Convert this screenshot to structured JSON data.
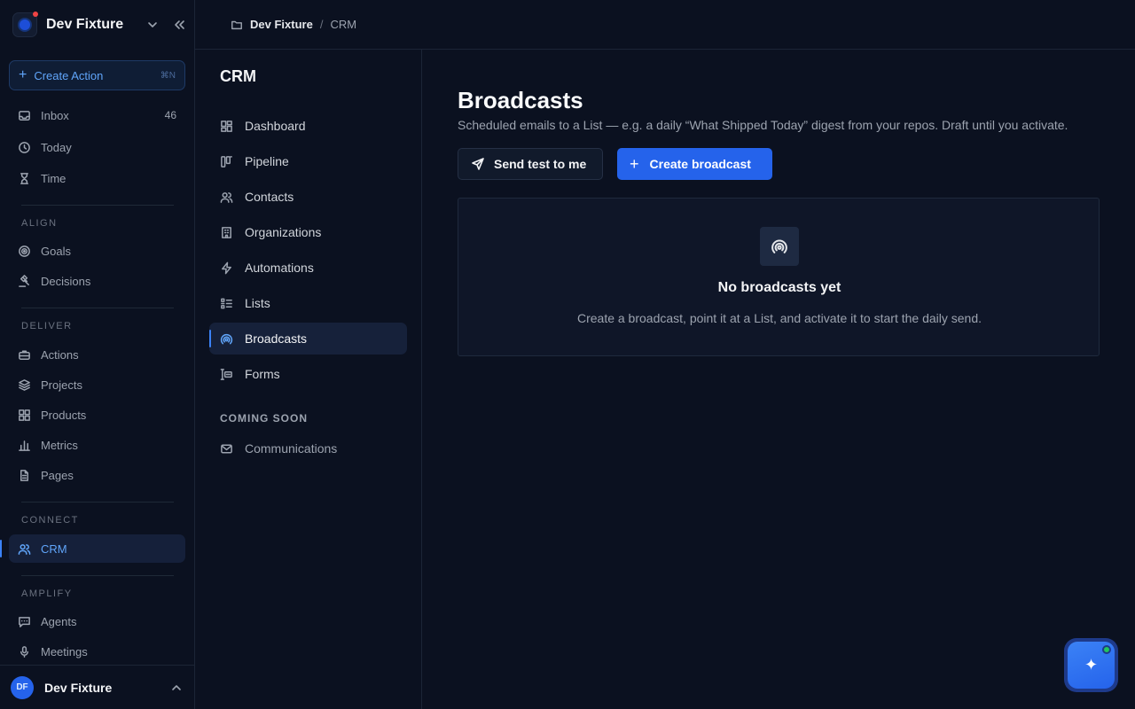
{
  "colors": {
    "accent": "#3b82f6",
    "primary_button": "#2563eb",
    "background": "#0b1120",
    "notification": "#ef4444",
    "online": "#22c55e"
  },
  "workspace": {
    "name": "Dev Fixture"
  },
  "create_action": {
    "label": "Create Action",
    "shortcut": "⌘N"
  },
  "sidebar": {
    "top_items": [
      {
        "label": "Inbox",
        "count": "46",
        "icon": "inbox-icon"
      },
      {
        "label": "Today",
        "icon": "clock-icon"
      },
      {
        "label": "Time",
        "icon": "hourglass-icon"
      }
    ],
    "sections": {
      "align": {
        "label": "ALIGN",
        "items": [
          {
            "label": "Goals",
            "icon": "target-icon"
          },
          {
            "label": "Decisions",
            "icon": "gavel-icon"
          }
        ]
      },
      "deliver": {
        "label": "DELIVER",
        "items": [
          {
            "label": "Actions",
            "icon": "briefcase-icon"
          },
          {
            "label": "Projects",
            "icon": "layers-icon"
          },
          {
            "label": "Products",
            "icon": "grid-icon"
          },
          {
            "label": "Metrics",
            "icon": "bar-chart-icon"
          },
          {
            "label": "Pages",
            "icon": "file-icon"
          }
        ]
      },
      "connect": {
        "label": "CONNECT",
        "items": [
          {
            "label": "CRM",
            "icon": "users-icon",
            "active": true
          }
        ]
      },
      "amplify": {
        "label": "AMPLIFY",
        "items": [
          {
            "label": "Agents",
            "icon": "chat-icon"
          },
          {
            "label": "Meetings",
            "icon": "mic-icon"
          }
        ]
      }
    }
  },
  "user": {
    "initials": "DF",
    "name": "Dev Fixture"
  },
  "breadcrumb": {
    "root": "Dev Fixture",
    "separator": "/",
    "current": "CRM"
  },
  "subnav": {
    "title": "CRM",
    "items": [
      {
        "label": "Dashboard",
        "icon": "dashboard-icon"
      },
      {
        "label": "Pipeline",
        "icon": "pipeline-icon"
      },
      {
        "label": "Contacts",
        "icon": "contacts-icon"
      },
      {
        "label": "Organizations",
        "icon": "building-icon"
      },
      {
        "label": "Automations",
        "icon": "bolt-icon"
      },
      {
        "label": "Lists",
        "icon": "list-icon"
      },
      {
        "label": "Broadcasts",
        "icon": "broadcast-icon",
        "active": true
      },
      {
        "label": "Forms",
        "icon": "form-icon"
      }
    ],
    "coming_soon_label": "COMING SOON",
    "coming_soon_items": [
      {
        "label": "Communications",
        "icon": "mail-icon"
      }
    ]
  },
  "main": {
    "title": "Broadcasts",
    "subtitle": "Scheduled emails to a List — e.g. a daily “What Shipped Today” digest from your repos. Draft until you activate.",
    "send_test_label": "Send test to me",
    "create_label": "Create broadcast",
    "empty": {
      "title": "No broadcasts yet",
      "description": "Create a broadcast, point it at a List, and activate it to start the daily send."
    }
  },
  "assistant": {
    "icon": "sparkle-icon",
    "status": "online"
  }
}
